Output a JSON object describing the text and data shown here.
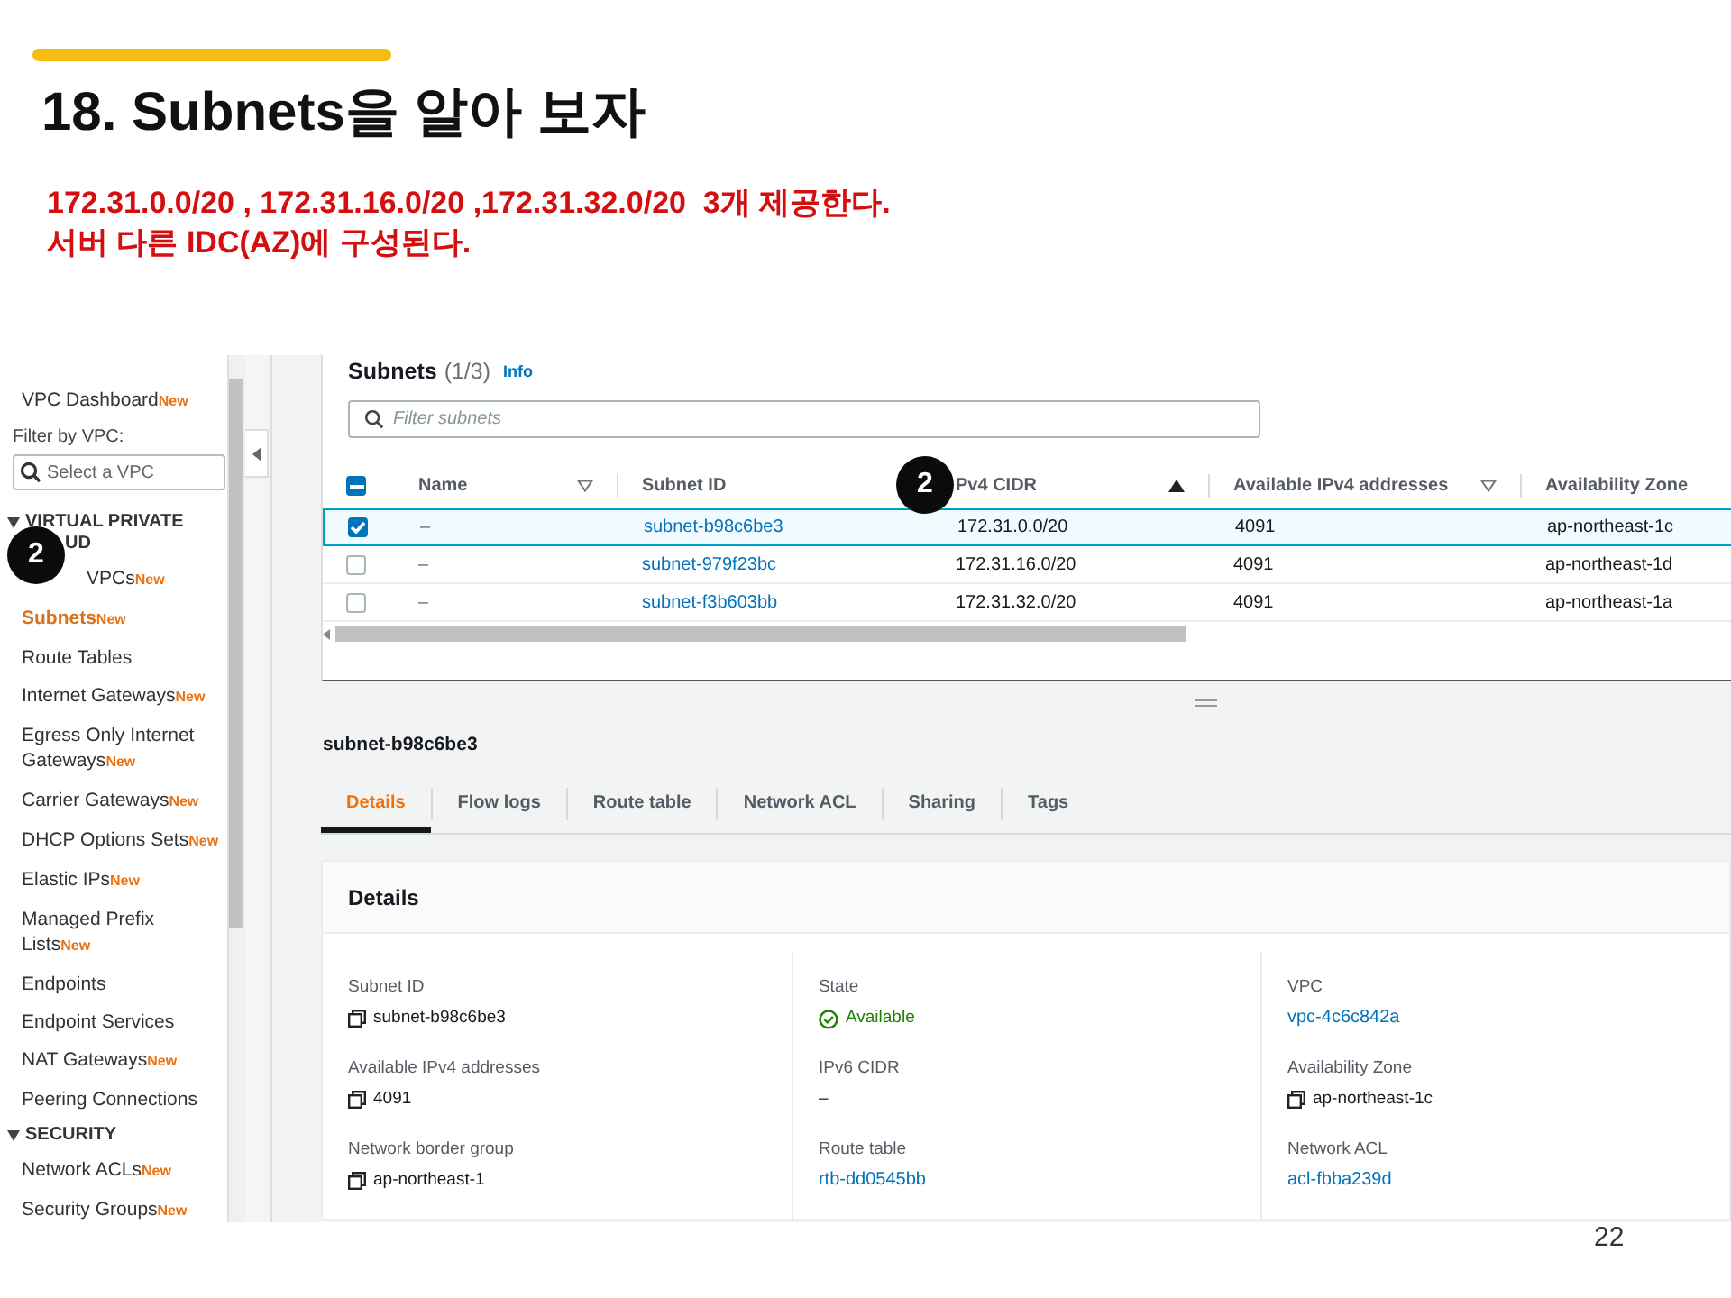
{
  "slide": {
    "title": "18. Subnets을 알아 보자",
    "notes": [
      "172.31.0.0/20 , 172.31.16.0/20 ,172.31.32.0/20  3개 제공한다.",
      "서버 다른 IDC(AZ)에 구성된다."
    ],
    "page_number": "22"
  },
  "callouts": [
    {
      "label": "2"
    },
    {
      "label": "2"
    }
  ],
  "sidebar": {
    "items": [
      {
        "kind": "link",
        "label": "VPC Dashboard",
        "badge": "New",
        "selected": false
      },
      {
        "kind": "filter",
        "label": "Filter by VPC:",
        "placeholder": "Select a VPC"
      },
      {
        "kind": "section",
        "label": "VIRTUAL PRIVATE",
        "label_2": "UD"
      },
      {
        "kind": "covered-link",
        "label": "VPCs",
        "badge": "New",
        "selected": false
      },
      {
        "kind": "link",
        "label": "Subnets",
        "badge": "New",
        "selected": true
      },
      {
        "kind": "link",
        "label": "Route Tables",
        "selected": false
      },
      {
        "kind": "link",
        "label": "Internet Gateways",
        "badge": "New",
        "selected": false
      },
      {
        "kind": "link",
        "label": "Egress Only Internet Gateways",
        "badge": "New",
        "selected": false
      },
      {
        "kind": "link",
        "label": "Carrier Gateways",
        "badge": "New",
        "selected": false
      },
      {
        "kind": "link",
        "label": "DHCP Options Sets",
        "badge": "New",
        "selected": false
      },
      {
        "kind": "link",
        "label": "Elastic IPs",
        "badge": "New",
        "selected": false
      },
      {
        "kind": "link",
        "label": "Managed Prefix Lists",
        "badge": "New",
        "selected": false
      },
      {
        "kind": "link",
        "label": "Endpoints",
        "selected": false
      },
      {
        "kind": "link",
        "label": "Endpoint Services",
        "selected": false
      },
      {
        "kind": "link",
        "label": "NAT Gateways",
        "badge": "New",
        "selected": false
      },
      {
        "kind": "link",
        "label": "Peering Connections",
        "selected": false
      },
      {
        "kind": "section",
        "label": "SECURITY"
      },
      {
        "kind": "link",
        "label": "Network ACLs",
        "badge": "New",
        "selected": false
      },
      {
        "kind": "link",
        "label": "Security Groups",
        "badge": "New",
        "selected": false
      }
    ]
  },
  "table": {
    "title": "Subnets",
    "count": "(1/3)",
    "info": "Info",
    "filter": {
      "placeholder": "Filter subnets"
    },
    "select_all": {
      "indeterminate": true
    },
    "columns": [
      {
        "label": "Name",
        "sorted": false
      },
      {
        "label": "Subnet ID"
      },
      {
        "label": "Pv4 CIDR",
        "sorted": true
      },
      {
        "label": "Available IPv4 addresses",
        "sorted": false
      },
      {
        "label": "Availability Zone"
      }
    ],
    "rows": [
      {
        "selected": true,
        "cells": [
          "–",
          "subnet-b98c6be3",
          "172.31.0.0/20",
          "4091",
          "ap-northeast-1c"
        ]
      },
      {
        "selected": false,
        "cells": [
          "–",
          "subnet-979f23bc",
          "172.31.16.0/20",
          "4091",
          "ap-northeast-1d"
        ]
      },
      {
        "selected": false,
        "cells": [
          "–",
          "subnet-f3b603bb",
          "172.31.32.0/20",
          "4091",
          "ap-northeast-1a"
        ]
      }
    ]
  },
  "details": {
    "subnet": "subnet-b98c6be3",
    "tabs": [
      {
        "label": "Details",
        "selected": true
      },
      {
        "label": "Flow logs",
        "selected": false
      },
      {
        "label": "Route table",
        "selected": false
      },
      {
        "label": "Network ACL",
        "selected": false
      },
      {
        "label": "Sharing",
        "selected": false
      },
      {
        "label": "Tags",
        "selected": false
      }
    ],
    "card_title": "Details",
    "columns": [
      [
        {
          "label": "Subnet ID",
          "value": "subnet-b98c6be3",
          "kind": "copy"
        },
        {
          "label": "Available IPv4 addresses",
          "value": "4091",
          "kind": "copy"
        },
        {
          "label": "Network border group",
          "value": "ap-northeast-1",
          "kind": "copy"
        }
      ],
      [
        {
          "label": "State",
          "value": "Available",
          "kind": "status"
        },
        {
          "label": "IPv6 CIDR",
          "value": "–",
          "kind": "plain"
        },
        {
          "label": "Route table",
          "value": "rtb-dd0545bb",
          "kind": "link"
        }
      ],
      [
        {
          "label": "VPC",
          "value": "vpc-4c6c842a",
          "kind": "link"
        },
        {
          "label": "Availability Zone",
          "value": "ap-northeast-1c",
          "kind": "copy"
        },
        {
          "label": "Network ACL",
          "value": "acl-fbba239d",
          "kind": "link"
        }
      ]
    ]
  }
}
